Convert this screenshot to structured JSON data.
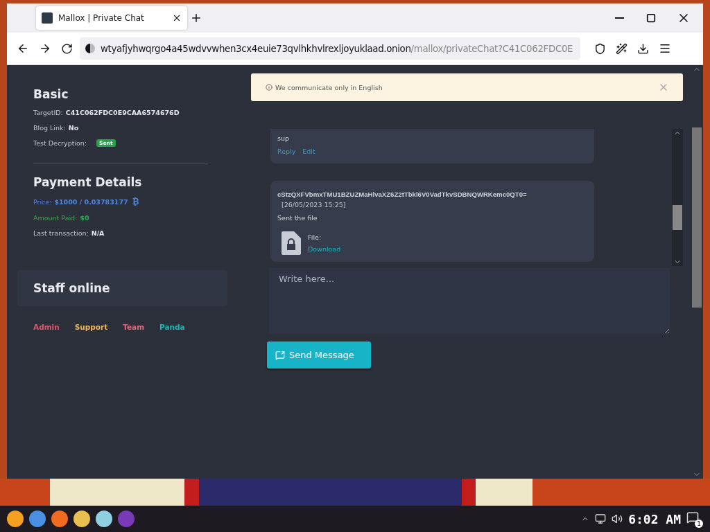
{
  "browser": {
    "tab_title": "Mallox | Private Chat",
    "url_host": "wtyafjyhwqrgo4a45wdvvwhen3cx4euie73qvlhkhvlrexljoyuklaad.onion",
    "url_path": "/mallox/privateChat?C41C062FDC0E"
  },
  "basic": {
    "title": "Basic",
    "rows": [
      {
        "label": "TargetID:",
        "value": "C41C062FDC0E9CAA6574676D"
      },
      {
        "label": "Blog Link:",
        "value": "No"
      },
      {
        "label": "Test Decryption:",
        "badge": "Sent"
      }
    ]
  },
  "payment": {
    "title": "Payment Details",
    "price_label": "Price:",
    "price_value": "$1000 / 0.03783177",
    "currency_symbol": "₿",
    "paid_label": "Amount Paid:",
    "paid_value": "$0",
    "last_label": "Last transaction:",
    "last_value": "N/A"
  },
  "staff": {
    "title": "Staff online",
    "members": [
      {
        "name": "Admin",
        "color": "#e0566e"
      },
      {
        "name": "Support",
        "color": "#f0b35a"
      },
      {
        "name": "Team",
        "color": "#e06a7a"
      },
      {
        "name": "Panda",
        "color": "#20b4b4"
      }
    ]
  },
  "notice": "We communicate only in English",
  "messages": [
    {
      "text": "sup",
      "actions": [
        "Reply",
        "Edit"
      ]
    },
    {
      "sender": "cStzQXFVbmxTMU1BZUZMaHlvaXZ6Z2tTbkl6V0VadTkvSDBNQWRKemc0QT0=",
      "date": "[26/05/2023 15:25]",
      "text": "Sent the file",
      "file_label": "File:",
      "file_link": "Download"
    }
  ],
  "composer": {
    "placeholder": "Write here...",
    "button": "Send Message"
  },
  "taskbar": {
    "time": "6:02 AM",
    "notifications": "1"
  }
}
